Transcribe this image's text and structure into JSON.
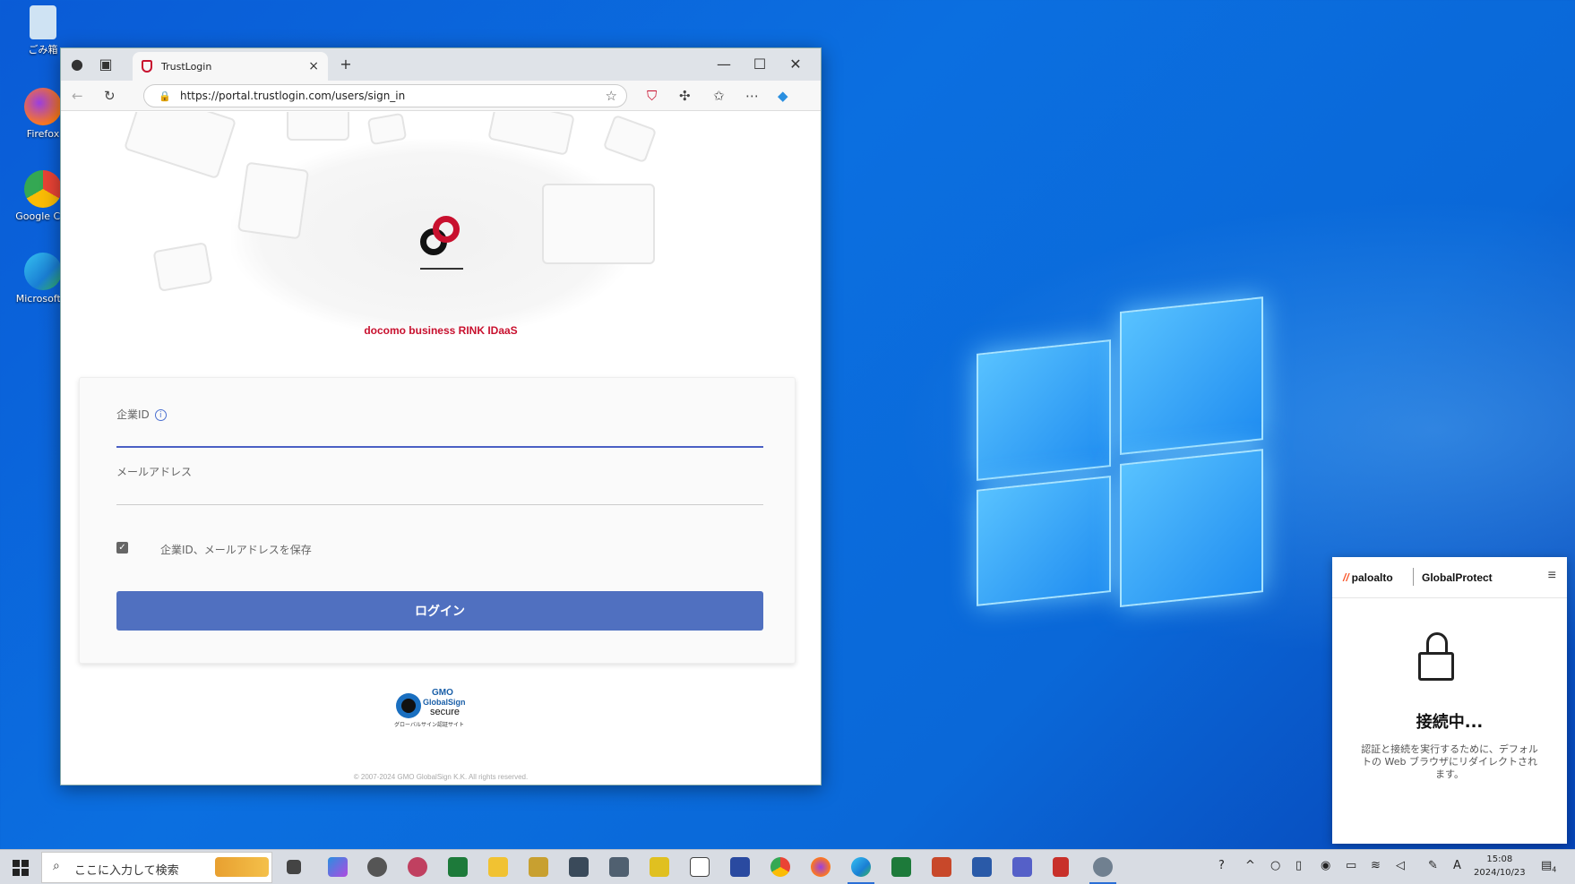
{
  "desktop": {
    "icons": [
      {
        "label": "ごみ箱",
        "icon": "recycle-bin-icon"
      },
      {
        "label": "Firefox",
        "icon": "firefox-icon"
      },
      {
        "label": "Google Chr",
        "icon": "chrome-icon"
      },
      {
        "label": "Microsoft E",
        "icon": "edge-icon"
      }
    ]
  },
  "browser": {
    "tab_title": "TrustLogin",
    "new_tab": "+",
    "tab_close": "×",
    "controls": {
      "minimize": "—",
      "maximize": "☐",
      "close": "✕"
    },
    "url": "https://portal.trustlogin.com/users/sign_in",
    "nav": {
      "back": "←",
      "reload": "↻"
    }
  },
  "page": {
    "brand_text": "docomo business RINK IDaaS",
    "form": {
      "company_id_label": "企業ID",
      "company_id_info": "i",
      "company_id_value": "",
      "email_label": "メールアドレス",
      "email_value": "",
      "save_checkbox_checked": true,
      "save_checkbox_mark": "✓",
      "save_label": "企業ID、メールアドレスを保存",
      "login_button": "ログイン"
    },
    "seal": {
      "line1": "GMO",
      "line2": "GlobalSign",
      "line3": "secure",
      "line4": "グローバルサイン認証サイト"
    },
    "copyright": "© 2007-2024 GMO GlobalSign K.K. All rights reserved."
  },
  "globalprotect": {
    "vendor": "paloalto",
    "product": "GlobalProtect",
    "menu": "≡",
    "status": "接続中...",
    "description": "認証と接続を実行するために、デフォルトの Web ブラウザにリダイレクトされます。"
  },
  "taskbar": {
    "search_placeholder": "ここに入力して検索",
    "time": "15:08",
    "date": "2024/10/23",
    "ime": "A",
    "notification_count": "4"
  },
  "colors": {
    "brand_red": "#c8102e",
    "login_button": "#5070c0",
    "desktop_blue": "#0a5bd6"
  }
}
